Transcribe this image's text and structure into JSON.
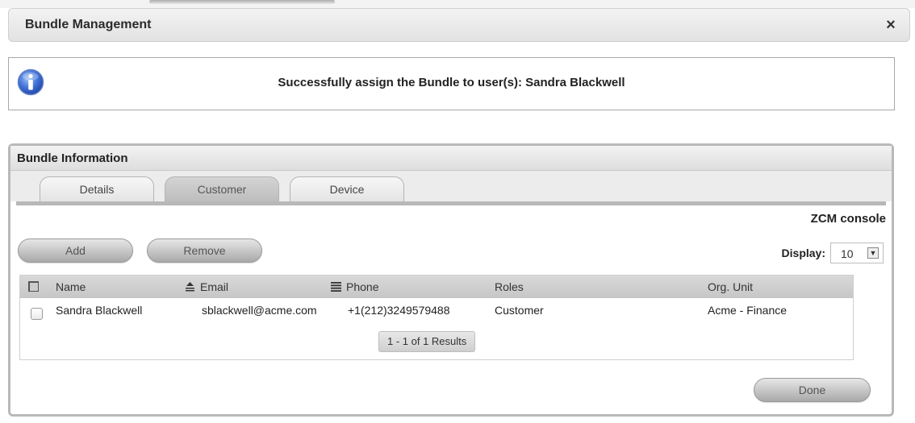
{
  "window": {
    "title": "Bundle Management",
    "close_icon": "×"
  },
  "notice": {
    "icon": "info-icon",
    "message": "Successfully assign the Bundle to user(s): Sandra Blackwell"
  },
  "panel": {
    "title": "Bundle Information",
    "tabs": [
      {
        "label": "Details",
        "active": false
      },
      {
        "label": "Customer",
        "active": true
      },
      {
        "label": "Device",
        "active": false
      }
    ],
    "context_label": "ZCM console",
    "buttons": {
      "add": "Add",
      "remove": "Remove",
      "done": "Done"
    },
    "display": {
      "label": "Display:",
      "value": "10"
    },
    "table": {
      "columns": [
        "Name",
        "Email",
        "Phone",
        "Roles",
        "Org. Unit"
      ],
      "rows": [
        {
          "name": "Sandra Blackwell",
          "email": "sblackwell@acme.com",
          "phone": "+1(212)3249579488",
          "roles": "Customer",
          "org_unit": "Acme - Finance"
        }
      ],
      "pager": "1 - 1 of 1 Results"
    }
  },
  "colors": {
    "panel_border": "#b9b9b9",
    "active_tab": "#c4c4c4",
    "header_bg": "#e2e2e2"
  }
}
